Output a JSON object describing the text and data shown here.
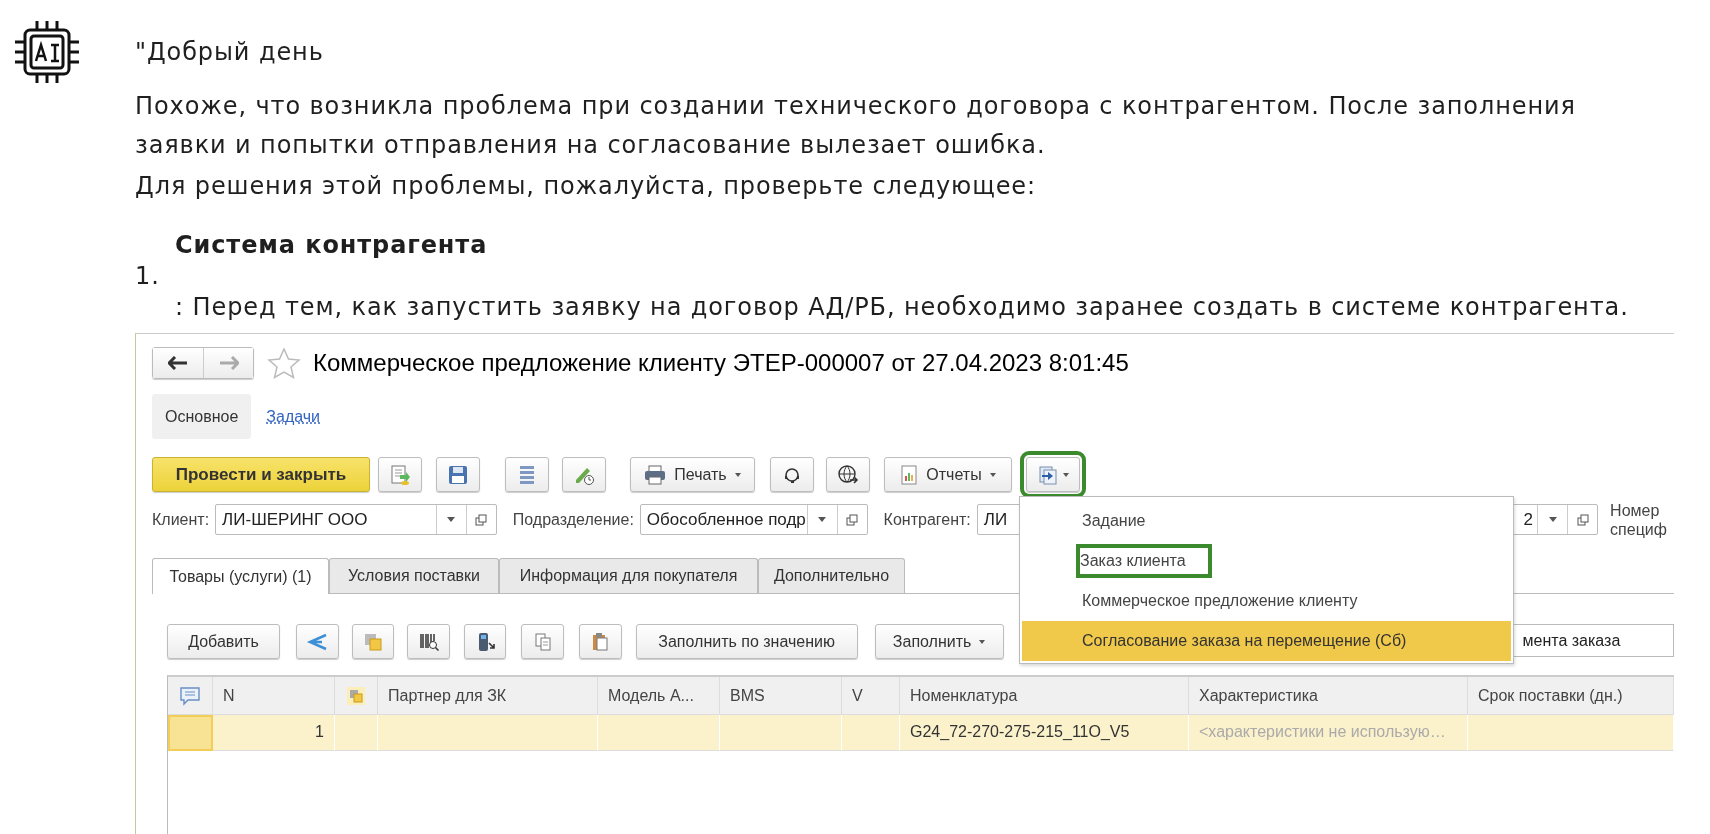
{
  "message": {
    "greeting": "\"Добрый день",
    "paragraphs": [
      "Похоже, что возникла проблема при создании технического договора с контрагентом. После заполнения заявки и попытки отправления на согласование вылезает ошибка.",
      "Для решения этой проблемы, пожалуйста, проверьте следующее:"
    ],
    "list": [
      {
        "number": "1.",
        "title": "Система контрагента",
        "text": ": Перед тем, как запустить заявку на договор АД/РБ, необходимо заранее создать в системе контрагента."
      }
    ]
  },
  "screenshot": {
    "title": "Коммерческое предложение клиенту ЭТЕР-000007 от 27.04.2023 8:01:45",
    "sections": [
      {
        "label": "Основное",
        "selected": true
      },
      {
        "label": "Задачи",
        "selected": false
      }
    ],
    "toolbar": {
      "post_button": "Провести и закрыть",
      "print_button": "Печать",
      "reports_button": "Отчеты",
      "create_button": {
        "outlined": true
      }
    },
    "fields": [
      {
        "label": "Клиент:",
        "value": "ЛИ-ШЕРИНГ ООО"
      },
      {
        "label": "Подразделение:",
        "value": "Обособленное подр"
      },
      {
        "label": "Контрагент:",
        "value": "ЛИ",
        "value_end": "2"
      }
    ],
    "number_label": "Номер специф",
    "tabs": [
      {
        "label": "Товары (услуги) (1)",
        "selected": true
      },
      {
        "label": "Условия поставки",
        "selected": false
      },
      {
        "label": "Информация для покупателя",
        "selected": false
      },
      {
        "label": "Дополнительно",
        "selected": false
      }
    ],
    "table_toolbar": {
      "add_button": "Добавить",
      "fill_by_value_button": "Заполнить по значению",
      "fill_button": "Заполнить",
      "search_value": "мента заказа"
    },
    "table": {
      "columns": [
        {
          "kind": "comment"
        },
        {
          "kind": "text",
          "label": "N"
        },
        {
          "kind": "linked"
        },
        {
          "kind": "text",
          "label": "Партнер для ЗК"
        },
        {
          "kind": "text",
          "label": "Модель А..."
        },
        {
          "kind": "text",
          "label": "BMS"
        },
        {
          "kind": "text",
          "label": "V"
        },
        {
          "kind": "text",
          "label": "Номенклатура"
        },
        {
          "kind": "text",
          "label": "Характеристика"
        },
        {
          "kind": "text",
          "label": "Срок поставки (дн.)"
        }
      ],
      "rows": [
        {
          "selected": true,
          "cells": [
            {
              "current": true
            },
            {
              "text": "1"
            },
            null,
            null,
            null,
            null,
            null,
            {
              "text": "G24_72-270-275-215_11O_V5"
            },
            {
              "text": "<характеристики не использую…",
              "muted": true
            },
            null
          ]
        }
      ]
    },
    "menu": {
      "items": [
        {
          "label": "Задание",
          "selected": false,
          "outlined": false
        },
        {
          "label": "Заказ клиента",
          "selected": false,
          "outlined": true
        },
        {
          "label": "Коммерческое предложение клиенту",
          "selected": false,
          "outlined": false
        },
        {
          "label": "Согласование заказа на перемещение (Сб)",
          "selected": true,
          "outlined": false
        }
      ]
    }
  }
}
